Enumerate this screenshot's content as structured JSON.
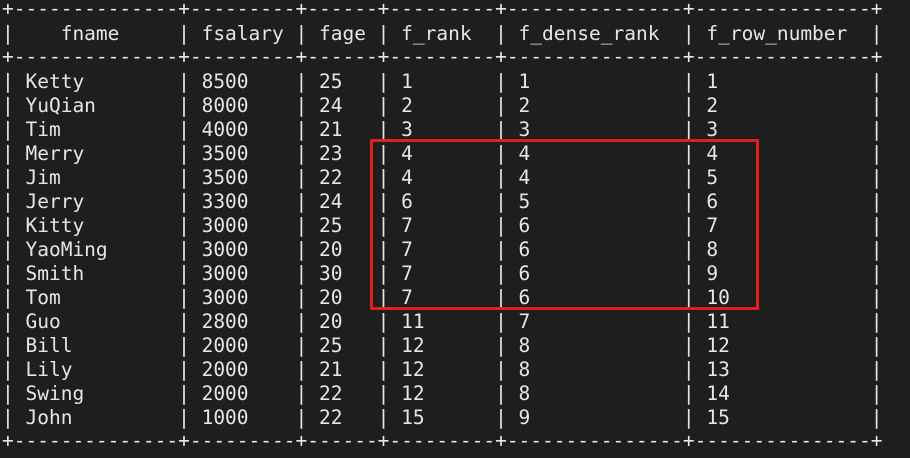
{
  "table": {
    "columns": [
      {
        "name": "fname",
        "pad": 14
      },
      {
        "name": "fsalary",
        "pad": 9
      },
      {
        "name": "fage",
        "pad": 6
      },
      {
        "name": "f_rank",
        "pad": 9
      },
      {
        "name": "f_dense_rank",
        "pad": 15
      },
      {
        "name": "f_row_number",
        "pad": 15
      }
    ],
    "header_centered": true,
    "rows": [
      [
        "Ketty",
        "8500",
        "25",
        "1",
        "1",
        "1"
      ],
      [
        "YuQian",
        "8000",
        "24",
        "2",
        "2",
        "2"
      ],
      [
        "Tim",
        "4000",
        "21",
        "3",
        "3",
        "3"
      ],
      [
        "Merry",
        "3500",
        "23",
        "4",
        "4",
        "4"
      ],
      [
        "Jim",
        "3500",
        "22",
        "4",
        "4",
        "5"
      ],
      [
        "Jerry",
        "3300",
        "24",
        "6",
        "5",
        "6"
      ],
      [
        "Kitty",
        "3000",
        "25",
        "7",
        "6",
        "7"
      ],
      [
        "YaoMing",
        "3000",
        "20",
        "7",
        "6",
        "8"
      ],
      [
        "Smith",
        "3000",
        "30",
        "7",
        "6",
        "9"
      ],
      [
        "Tom",
        "3000",
        "20",
        "7",
        "6",
        "10"
      ],
      [
        "Guo",
        "2800",
        "20",
        "11",
        "7",
        "11"
      ],
      [
        "Bill",
        "2000",
        "25",
        "12",
        "8",
        "12"
      ],
      [
        "Lily",
        "2000",
        "21",
        "12",
        "8",
        "13"
      ],
      [
        "Swing",
        "2000",
        "22",
        "12",
        "8",
        "14"
      ],
      [
        "John",
        "1000",
        "22",
        "15",
        "9",
        "15"
      ]
    ]
  },
  "colors": {
    "background": "#1e1e1e",
    "text": "#e6e6e6",
    "highlight_border": "#e02020"
  }
}
